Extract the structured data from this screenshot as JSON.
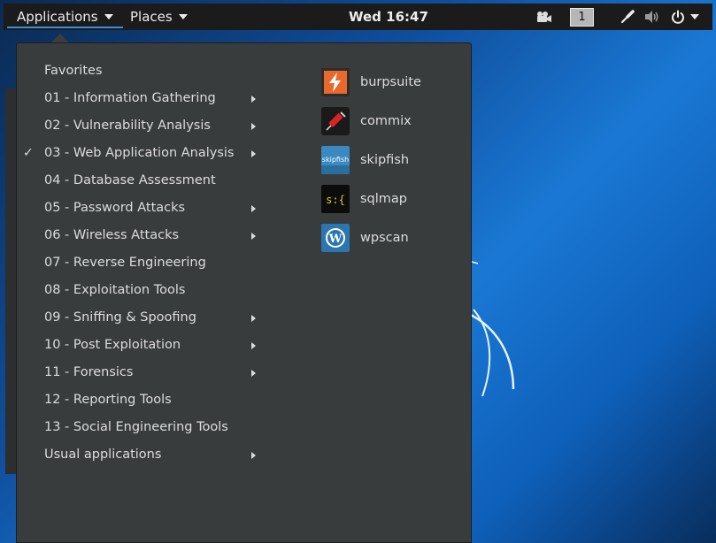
{
  "topbar": {
    "applications_label": "Applications",
    "places_label": "Places",
    "clock": "Wed 16:47",
    "workspace_number": "1",
    "icons": [
      "video-camera-icon",
      "pen-tool-icon",
      "volume-icon",
      "power-icon",
      "chevron-down-icon"
    ]
  },
  "menu": {
    "categories": [
      {
        "label": "Favorites",
        "has_submenu": false,
        "checked": false
      },
      {
        "label": "01 - Information Gathering",
        "has_submenu": true,
        "checked": false
      },
      {
        "label": "02 - Vulnerability Analysis",
        "has_submenu": true,
        "checked": false
      },
      {
        "label": "03 - Web Application Analysis",
        "has_submenu": true,
        "checked": true
      },
      {
        "label": "04 - Database Assessment",
        "has_submenu": false,
        "checked": false
      },
      {
        "label": "05 - Password Attacks",
        "has_submenu": true,
        "checked": false
      },
      {
        "label": "06 - Wireless Attacks",
        "has_submenu": true,
        "checked": false
      },
      {
        "label": "07 - Reverse Engineering",
        "has_submenu": false,
        "checked": false
      },
      {
        "label": "08 - Exploitation Tools",
        "has_submenu": false,
        "checked": false
      },
      {
        "label": "09 - Sniffing & Spoofing",
        "has_submenu": true,
        "checked": false
      },
      {
        "label": "10 - Post Exploitation",
        "has_submenu": true,
        "checked": false
      },
      {
        "label": "11 - Forensics",
        "has_submenu": true,
        "checked": false
      },
      {
        "label": "12 - Reporting Tools",
        "has_submenu": false,
        "checked": false
      },
      {
        "label": "13 - Social Engineering Tools",
        "has_submenu": false,
        "checked": false
      },
      {
        "label": "Usual applications",
        "has_submenu": true,
        "checked": false
      }
    ],
    "check_glyph": "✓",
    "apps": [
      {
        "label": "burpsuite",
        "icon": "burpsuite-icon",
        "color": "#e8692b"
      },
      {
        "label": "commix",
        "icon": "commix-syringe-icon",
        "color": "#1a1a1a"
      },
      {
        "label": "skipfish",
        "icon": "skipfish-icon",
        "color": "#3a89c0"
      },
      {
        "label": "sqlmap",
        "icon": "sqlmap-icon",
        "color": "#0c0c0c"
      },
      {
        "label": "wpscan",
        "icon": "wordpress-icon",
        "color": "#2b76b0"
      }
    ]
  }
}
